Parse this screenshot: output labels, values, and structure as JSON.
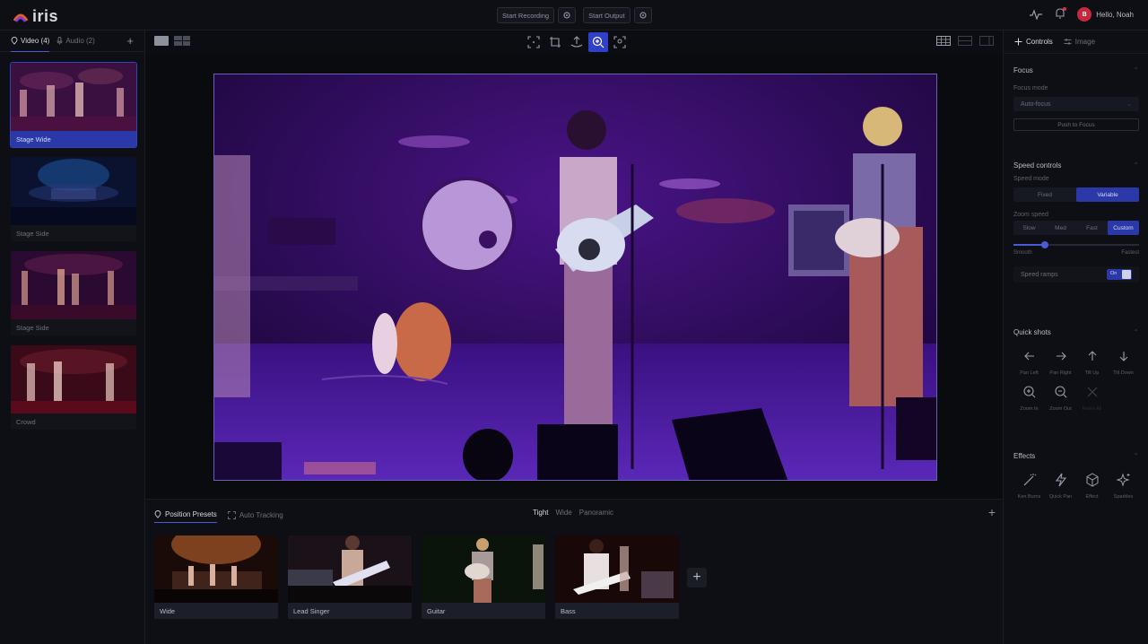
{
  "app": {
    "name": "iris"
  },
  "header": {
    "start_recording": "Start Recording",
    "start_output": "Start Output",
    "greeting": "Hello, Noah",
    "avatar_initial": "B"
  },
  "sources": {
    "tabs": [
      {
        "label": "Video (4)"
      },
      {
        "label": "Audio (2)"
      }
    ],
    "add": "+",
    "items": [
      {
        "label": "Stage Wide"
      },
      {
        "label": "Stage Side"
      },
      {
        "label": "Stage Side"
      },
      {
        "label": "Crowd"
      }
    ]
  },
  "bottom": {
    "tabs": [
      {
        "label": "Position Presets"
      },
      {
        "label": "Auto Tracking"
      }
    ],
    "sizes": [
      "Tight",
      "Wide",
      "Panoramic"
    ],
    "add": "+",
    "presets": [
      {
        "label": "Wide"
      },
      {
        "label": "Lead Singer"
      },
      {
        "label": "Guitar"
      },
      {
        "label": "Bass"
      }
    ],
    "preset_add": "+"
  },
  "panel": {
    "tabs": [
      {
        "label": "Controls"
      },
      {
        "label": "Image"
      }
    ],
    "focus": {
      "title": "Focus",
      "mode_label": "Focus mode",
      "mode_value": "Auto-focus",
      "button": "Push to Focus"
    },
    "speed": {
      "title": "Speed controls",
      "mode_label": "Speed mode",
      "modes": [
        "Fixed",
        "Variable"
      ],
      "zoom_label": "Zoom speed",
      "zoom_options": [
        "Slow",
        "Med",
        "Fast",
        "Custom"
      ],
      "slider_min": "Smooth",
      "slider_max": "Fastest",
      "slider_value": 0.25,
      "ramps_label": "Speed ramps",
      "ramps_state": "On"
    },
    "quick_shots": {
      "title": "Quick shots",
      "items": [
        {
          "label": "Pan Left"
        },
        {
          "label": "Pan Right"
        },
        {
          "label": "Tilt Up"
        },
        {
          "label": "Tilt Down"
        },
        {
          "label": "Zoom In"
        },
        {
          "label": "Zoom Out"
        },
        {
          "label": "Reset All"
        }
      ]
    },
    "effects": {
      "title": "Effects",
      "items": [
        {
          "label": "Ken Burns"
        },
        {
          "label": "Quick Pan"
        },
        {
          "label": "Effect"
        },
        {
          "label": "Sparkles"
        }
      ]
    }
  },
  "colors": {
    "accent": "#3040c8",
    "accent_dark": "#2b38a8",
    "avatar": "#c8283c"
  }
}
